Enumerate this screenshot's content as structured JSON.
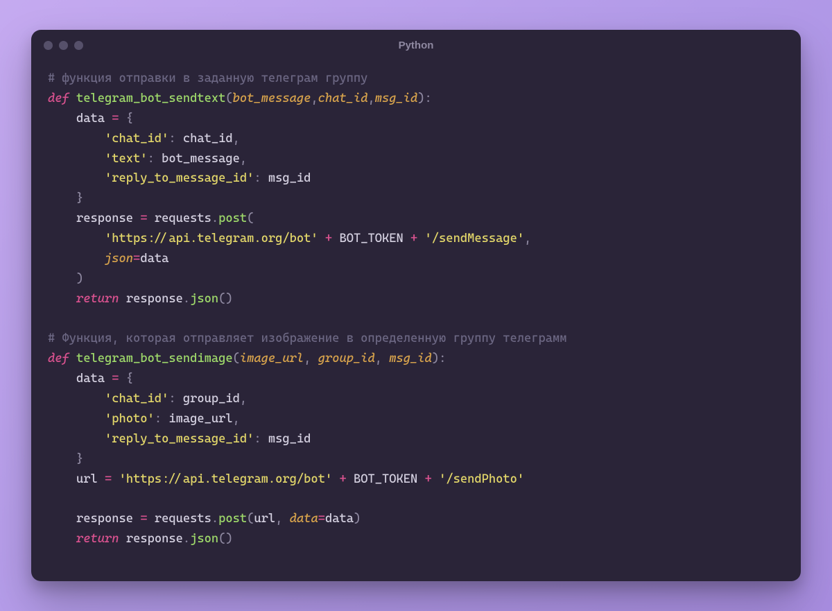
{
  "window": {
    "title": "Python"
  },
  "code": {
    "c1": "# функция отправки в заданную телеграм группу",
    "kw_def": "def",
    "fn1": "telegram_bot_sendtext",
    "p1a": "bot_message",
    "p1b": "chat_id",
    "p1c": "msg_id",
    "data_var": "data",
    "eq": "=",
    "lbrace": "{",
    "k_chat_id": "'chat_id'",
    "v_chat_id": "chat_id",
    "k_text": "'text'",
    "v_text": "bot_message",
    "k_reply": "'reply_to_message_id'",
    "v_reply": "msg_id",
    "rbrace": "}",
    "resp_var": "response",
    "requests": "requests",
    "post": "post",
    "url1": "'https://api.telegram.org/bot'",
    "plus": "+",
    "bot_token": "BOT_TOKEN",
    "url1b": "'/sendMessage'",
    "json_kw": "json",
    "kw_return": "return",
    "json_m": "json",
    "c2": "# Функция, которая отправляет изображение в определенную группу телеграмм",
    "fn2": "telegram_bot_sendimage",
    "p2a": "image_url",
    "p2b": "group_id",
    "p2c": "msg_id",
    "v_group": "group_id",
    "k_photo": "'photo'",
    "v_photo": "image_url",
    "url_var": "url",
    "url2b": "'/sendPhoto'",
    "data_kw": "data",
    "lparen": "(",
    "rparen": ")",
    "colon": ":",
    "comma": ",",
    "dot": "."
  }
}
